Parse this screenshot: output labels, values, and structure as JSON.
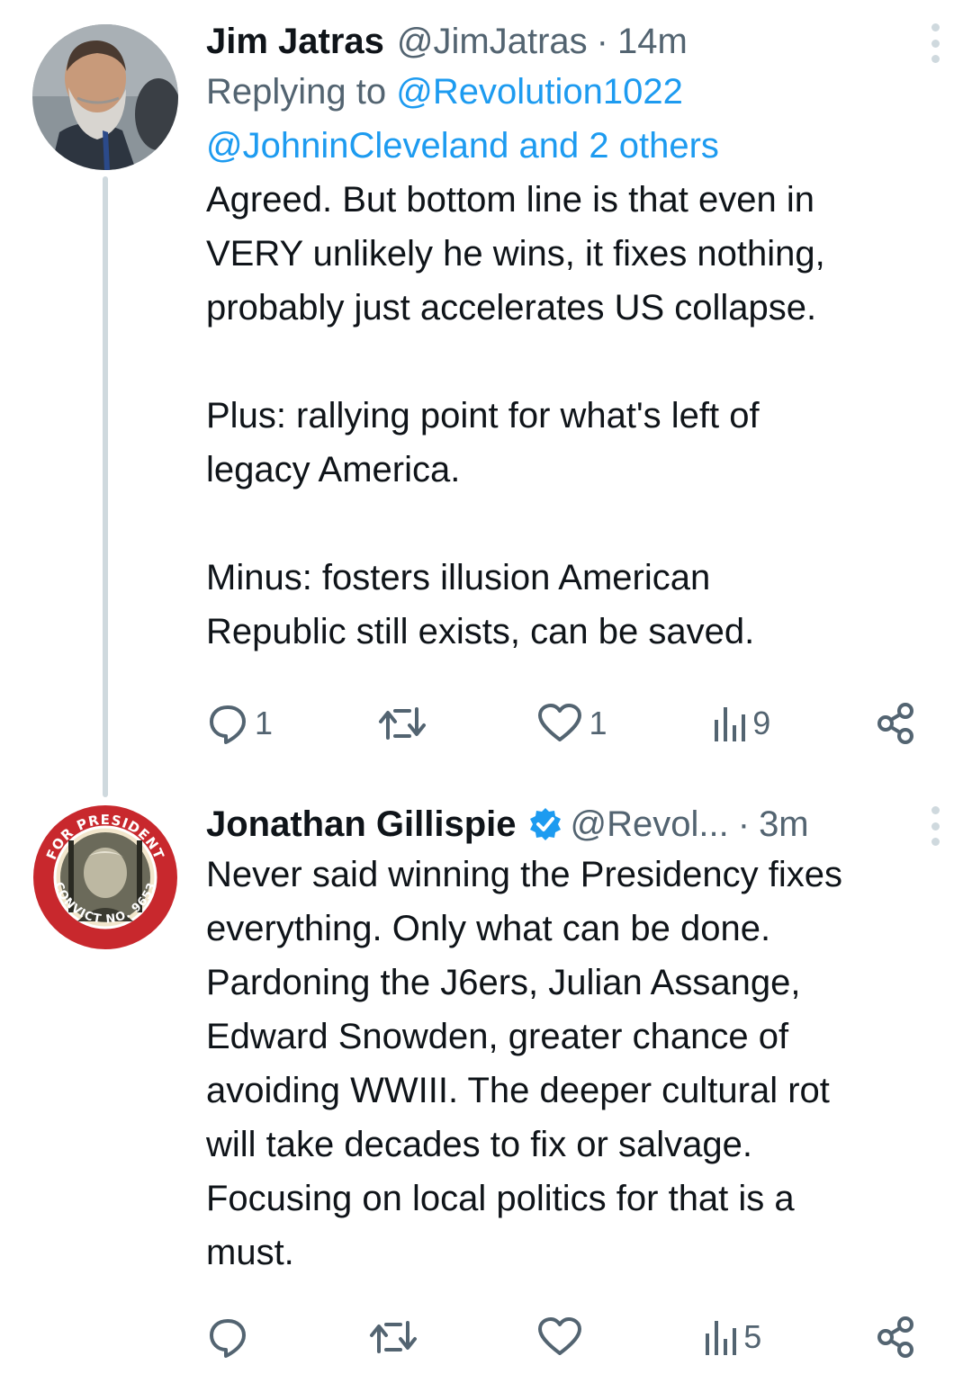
{
  "tweets": [
    {
      "name": "Jim Jatras",
      "handle": "@JimJatras",
      "separator": "·",
      "time": "14m",
      "replying_to_label": "Replying to",
      "replying_to_mention1": "@Revolution1022",
      "replying_to_mention2": "@JohninCleveland",
      "replying_to_and": "and",
      "replying_to_others": "2 others",
      "body": "Agreed. But bottom line is that even in\nVERY unlikely he wins, it fixes nothing,\nprobably just accelerates US collapse.\n\nPlus: rallying point for what's left of\nlegacy America.\n\nMinus: fosters illusion American\nRepublic still exists, can be saved.",
      "actions": {
        "replies": "1",
        "retweets": "",
        "likes": "1",
        "views": "9"
      },
      "avatar_icon": "bearded-man-portrait"
    },
    {
      "name": "Jonathan Gillispie",
      "handle": "@Revol...",
      "separator": "·",
      "time": "3m",
      "verified": true,
      "body": "Never said winning the Presidency fixes\neverything. Only what can be done.\nPardoning the J6ers, Julian Assange,\nEdward Snowden, greater chance of\navoiding WWIII. The deeper cultural rot\nwill take decades to fix or salvage.\nFocusing on local politics for that is a\nmust.",
      "actions": {
        "replies": "",
        "retweets": "",
        "likes": "",
        "views": "5"
      },
      "avatar_icon": "campaign-button-portrait",
      "avatar_text_top": "FOR PRESIDENT",
      "avatar_text_bottom": "CONVICT NO. 9653"
    }
  ],
  "colors": {
    "accent": "#1d9bf0",
    "secondary": "#536471",
    "line": "#cfd9de",
    "button_red": "#c8282d"
  },
  "icons": [
    "reply-icon",
    "retweet-icon",
    "like-icon",
    "views-icon",
    "share-icon",
    "verified-badge-icon",
    "more-icon"
  ]
}
